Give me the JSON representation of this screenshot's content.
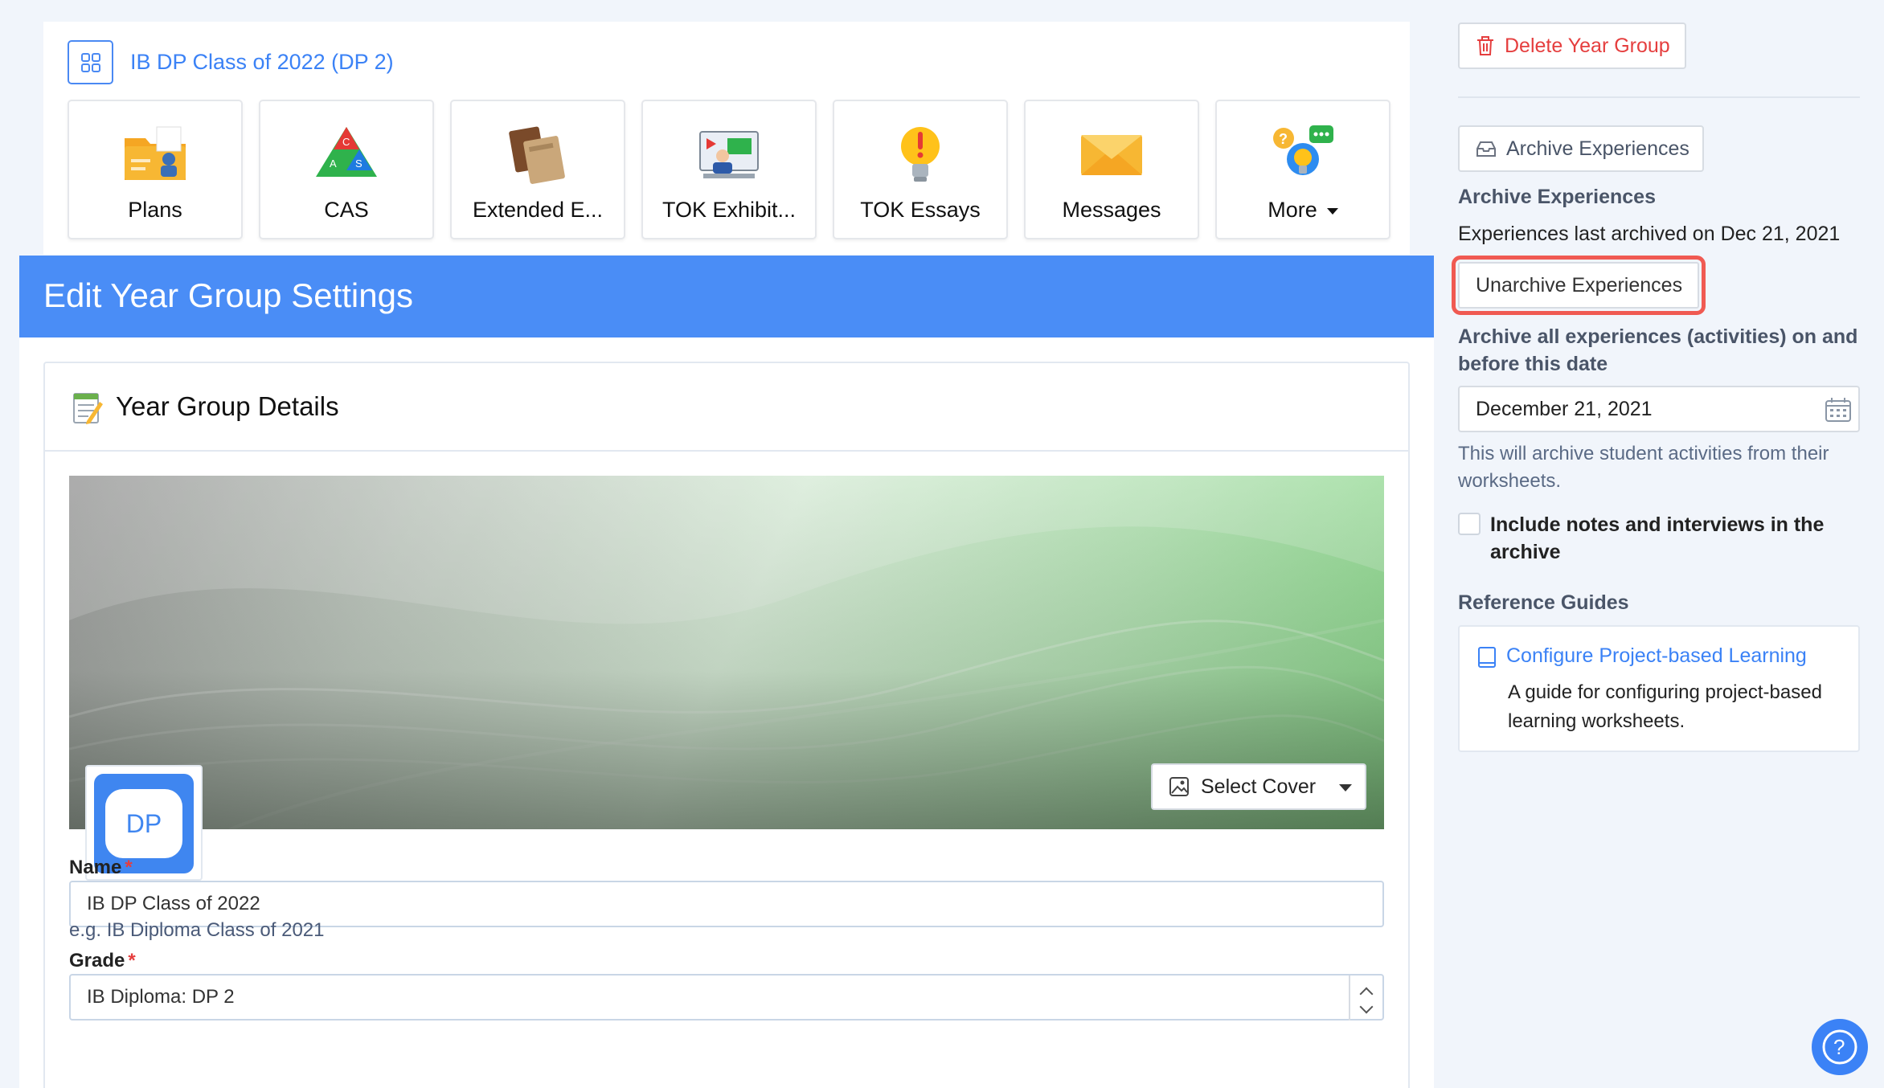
{
  "year_group": {
    "title": "IB DP Class of 2022 (DP 2)"
  },
  "tiles": [
    {
      "label": "Plans",
      "icon": "plans-folder-icon"
    },
    {
      "label": "CAS",
      "icon": "cas-triangle-icon"
    },
    {
      "label": "Extended E...",
      "icon": "books-icon"
    },
    {
      "label": "TOK Exhibit...",
      "icon": "presentation-icon"
    },
    {
      "label": "TOK Essays",
      "icon": "lightbulb-icon"
    },
    {
      "label": "Messages",
      "icon": "envelope-icon"
    },
    {
      "label": "More",
      "icon": "question-bubbles-icon"
    }
  ],
  "banner": {
    "title": "Edit Year Group Settings"
  },
  "details": {
    "title": "Year Group Details",
    "avatar_text": "DP",
    "select_cover_label": "Select Cover",
    "name_label": "Name",
    "name_value": "IB DP Class of 2022",
    "name_hint": "e.g. IB Diploma Class of 2021",
    "grade_label": "Grade",
    "grade_value": "IB Diploma: DP 2",
    "required_mark": "*"
  },
  "sidebar": {
    "delete_label": "Delete Year Group",
    "archive_button_label": "Archive Experiences",
    "archive_heading": "Archive Experiences",
    "last_archived": "Experiences last archived on Dec 21, 2021",
    "unarchive_label": "Unarchive Experiences",
    "archive_all_text": "Archive all experiences (activities) on and before this date",
    "archive_date": "December 21, 2021",
    "archive_note": "This will archive student activities from their worksheets.",
    "include_notes_label": "Include notes and interviews in the archive",
    "include_notes_checked": false,
    "reference_heading": "Reference Guides",
    "guide_title": "Configure Project-based Learning",
    "guide_desc": "A guide for configuring project-based learning worksheets."
  },
  "colors": {
    "accent": "#3b82f6",
    "banner": "#4a8df6",
    "danger": "#e53e3e",
    "highlight": "#f05a52"
  }
}
